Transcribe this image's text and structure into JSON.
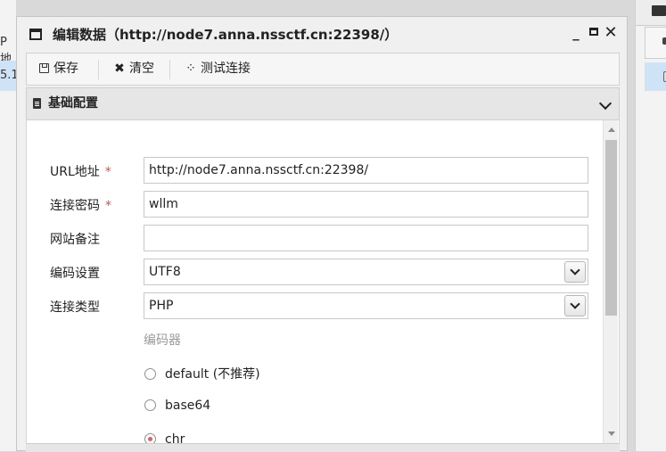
{
  "background": {
    "left_fragment_1": "P地",
    "left_fragment_2": "5.1"
  },
  "window": {
    "title": "编辑数据（http://node7.anna.nssctf.cn:22398/）",
    "controls": {
      "minimize": "_",
      "close": "✕"
    }
  },
  "toolbar": {
    "save_label": "保存",
    "clear_label": "清空",
    "test_label": "测试连接",
    "clear_icon": "✖",
    "test_icon": "⁘"
  },
  "section": {
    "title": "基础配置"
  },
  "form": {
    "url": {
      "label": "URL地址",
      "required_mark": "*",
      "value": "http://node7.anna.nssctf.cn:22398/"
    },
    "password": {
      "label": "连接密码",
      "required_mark": "*",
      "value": "wllm"
    },
    "note": {
      "label": "网站备注",
      "value": ""
    },
    "encoding": {
      "label": "编码设置",
      "selected": "UTF8"
    },
    "conn_type": {
      "label": "连接类型",
      "selected": "PHP"
    },
    "encoder": {
      "label": "编码器",
      "options": [
        "default (不推荐)",
        "base64",
        "chr"
      ],
      "selected": "chr"
    }
  },
  "colors": {
    "required": "#e24b4b",
    "selection": "#cfe3f6",
    "radio_selected": "#e06060"
  }
}
